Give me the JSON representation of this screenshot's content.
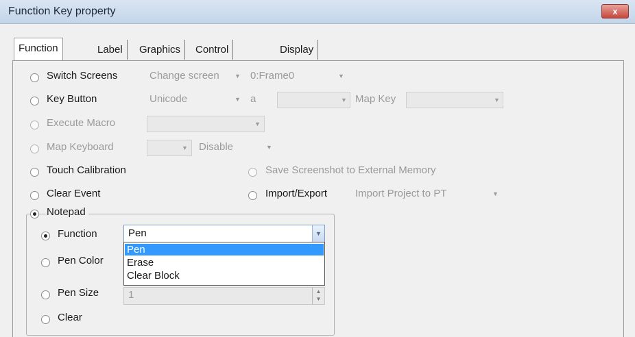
{
  "window": {
    "title": "Function Key property",
    "close_label": "x"
  },
  "tabs": [
    {
      "label": "Function Key"
    },
    {
      "label": "Label"
    },
    {
      "label": "Graphics"
    },
    {
      "label": "Control Setting"
    },
    {
      "label": "Display Setting"
    }
  ],
  "options": {
    "switch_screens": {
      "label": "Switch Screens",
      "combo1": "Change screen",
      "combo2": "0:Frame0"
    },
    "key_button": {
      "label": "Key Button",
      "combo1": "Unicode",
      "text": "a",
      "map_key_label": "Map Key"
    },
    "execute_macro": {
      "label": "Execute Macro"
    },
    "map_keyboard": {
      "label": "Map Keyboard",
      "combo2": "Disable"
    },
    "touch_calibration": {
      "label": "Touch Calibration"
    },
    "save_screenshot": {
      "label": "Save Screenshot to External Memory"
    },
    "clear_event": {
      "label": "Clear Event"
    },
    "import_export": {
      "label": "Import/Export",
      "combo": "Import Project to PT"
    },
    "notepad": {
      "label": "Notepad"
    }
  },
  "notepad": {
    "function_label": "Function",
    "function_value": "Pen",
    "function_options": [
      "Pen",
      "Erase",
      "Clear Block"
    ],
    "pen_color_label": "Pen Color",
    "pen_size_label": "Pen Size",
    "pen_size_value": "1",
    "clear_label": "Clear"
  },
  "colors": {
    "selection": "#3399ff",
    "titlebar": "#c4d5ea",
    "close": "#c6473c"
  }
}
